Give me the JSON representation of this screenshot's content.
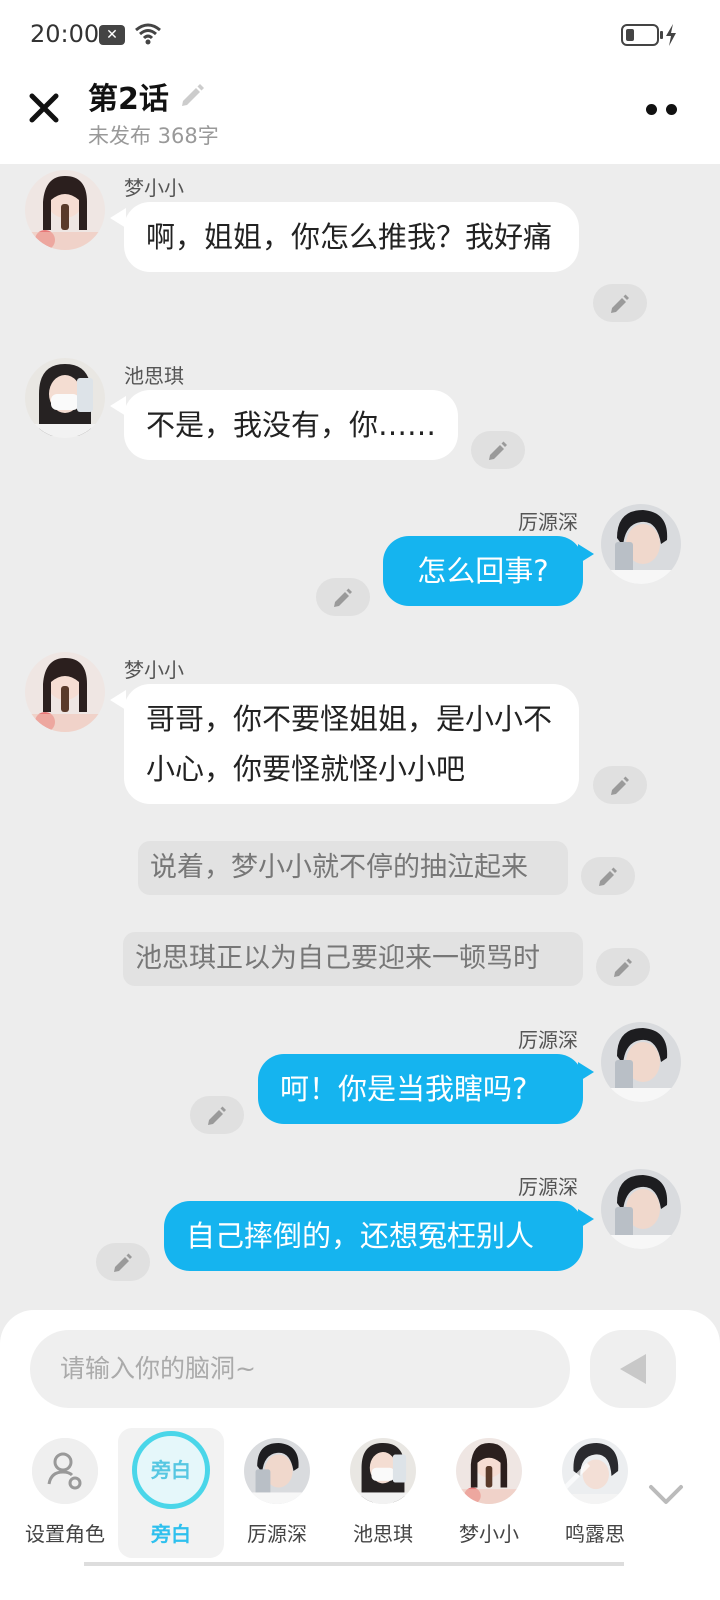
{
  "status": {
    "time": "20:00"
  },
  "header": {
    "title": "第2话",
    "subtitle": "未发布 368字"
  },
  "messages": [
    {
      "name": "梦小小",
      "text": "啊，姐姐，你怎么推我？我好痛"
    },
    {
      "name": "池思琪",
      "text": "不是，我没有，你……"
    },
    {
      "name": "厉源深",
      "text": "怎么回事?"
    },
    {
      "name": "梦小小",
      "text": "哥哥，你不要怪姐姐，是小小不小心，你要怪就怪小小吧"
    },
    {
      "narration": "说着，梦小小就不停的抽泣起来"
    },
    {
      "narration": "池思琪正以为自己要迎来一顿骂时"
    },
    {
      "name": "厉源深",
      "text": "呵！你是当我瞎吗?"
    },
    {
      "name": "厉源深",
      "text": "自己摔倒的，还想冤枉别人"
    }
  ],
  "composer": {
    "placeholder": "请输入你的脑洞~"
  },
  "roles": [
    {
      "label": "设置角色"
    },
    {
      "label": "旁白",
      "badge": "旁白"
    },
    {
      "label": "厉源深"
    },
    {
      "label": "池思琪"
    },
    {
      "label": "梦小小"
    },
    {
      "label": "鸣露思"
    }
  ],
  "colors": {
    "accent": "#15b4ef",
    "narrator": "#2ec0ee"
  }
}
